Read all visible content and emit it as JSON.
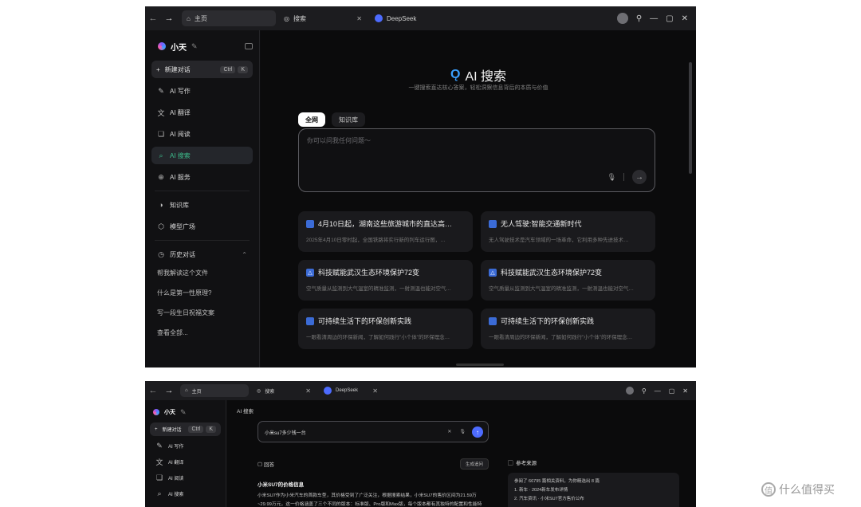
{
  "shot1": {
    "titlebar": {
      "tabs": [
        {
          "label": "主页",
          "icon": "home-icon"
        },
        {
          "label": "搜索",
          "icon": "globe-icon"
        },
        {
          "label": "DeepSeek",
          "icon": "deepseek-logo"
        }
      ]
    },
    "sidebar": {
      "app_name": "小天",
      "new_chat": {
        "label": "新建对话",
        "kbd": [
          "Ctrl",
          "K"
        ]
      },
      "items": [
        {
          "label": "AI 写作",
          "icon": "pen-icon"
        },
        {
          "label": "AI 翻译",
          "icon": "translate-icon"
        },
        {
          "label": "AI 阅读",
          "icon": "read-icon"
        },
        {
          "label": "AI 搜索",
          "icon": "search-icon",
          "active": true
        },
        {
          "label": "AI 服务",
          "icon": "service-icon"
        }
      ],
      "tools": [
        {
          "label": "知识库",
          "icon": "knowledge-icon"
        },
        {
          "label": "模型广场",
          "icon": "cube-icon"
        }
      ],
      "history": {
        "label": "历史对话",
        "items": [
          "帮我解读这个文件",
          "什么是第一性原理?",
          "写一段生日祝福文案",
          "查看全部..."
        ]
      }
    },
    "main": {
      "title": "AI 搜索",
      "subtitle": "一键搜索直达核心答案，轻松洞察信息背后的本质与价值",
      "scopes": [
        "全网",
        "知识库"
      ],
      "search_placeholder": "你可以问我任何问题～",
      "cards": [
        {
          "title": "4月10日起，湖南这些旅游城市的直达高…",
          "desc": "2025年4月10日零时起，全国铁路将实行新的列车运行图，…",
          "icon": "news-icon"
        },
        {
          "title": "无人驾驶:智能交通新时代",
          "desc": "无人驾驶技术是汽车领域的一场革命，它利用多种先进技术…",
          "icon": "car-icon"
        },
        {
          "title": "科技赋能武汉生态环境保护72变",
          "desc": "空气质量从监测到大气温室的精准监测，一射测温也能对空气…",
          "icon": "eco-icon"
        },
        {
          "title": "科技赋能武汉生态环境保护72变",
          "desc": "空气质量从监测到大气温室的精准监测，一射测温也能对空气…",
          "icon": "eco-icon"
        },
        {
          "title": "可持续生活下的环保创新实践",
          "desc": "一眼看清周边的环保新闻，了解如何践行\"小个体\"的环保理念…",
          "icon": "leaf-icon"
        },
        {
          "title": "可持续生活下的环保创新实践",
          "desc": "一眼看清周边的环保新闻，了解如何践行\"小个体\"的环保理念…",
          "icon": "leaf-icon"
        }
      ]
    }
  },
  "shot2": {
    "titlebar": {
      "tabs": [
        "主页",
        "搜索",
        "DeepSeek"
      ]
    },
    "sidebar": {
      "app_name": "小天",
      "new_chat": {
        "label": "新建对话",
        "kbd": [
          "Ctrl",
          "K"
        ]
      },
      "items": [
        "AI 写作",
        "AI 翻译",
        "AI 阅读",
        "AI 搜索"
      ]
    },
    "main": {
      "crumb": "AI 搜索",
      "query": "小米su7多少钱一台",
      "answer_label": "回答",
      "answer_chip": "生成追问",
      "answer_title": "小米SU7的价格信息",
      "answer_body": "小米SU7作为小米汽车的首款车型，其价格受到了广泛关注，根据搜索结果，小米SU7的售价区间为21.59万~29.99万元，这一价格涵盖了三个不同的版本：标准版、Pro版和Max版，每个版本都有其独特的配置和性能特点。",
      "ref_label": "参考来源",
      "ref_summary": "参阅了 66795 篇相关资料，为你精选出 8 篇",
      "ref_items": [
        "1. 新车 · 2024新车发布详情",
        "2. 汽车资讯 · 小米SU7官方售价公布"
      ]
    }
  },
  "watermark": "什么值得买",
  "colors": {
    "accent_green": "#3dbf8d",
    "accent_blue": "#3aa0ff",
    "send_blue": "#4d6bfe"
  }
}
